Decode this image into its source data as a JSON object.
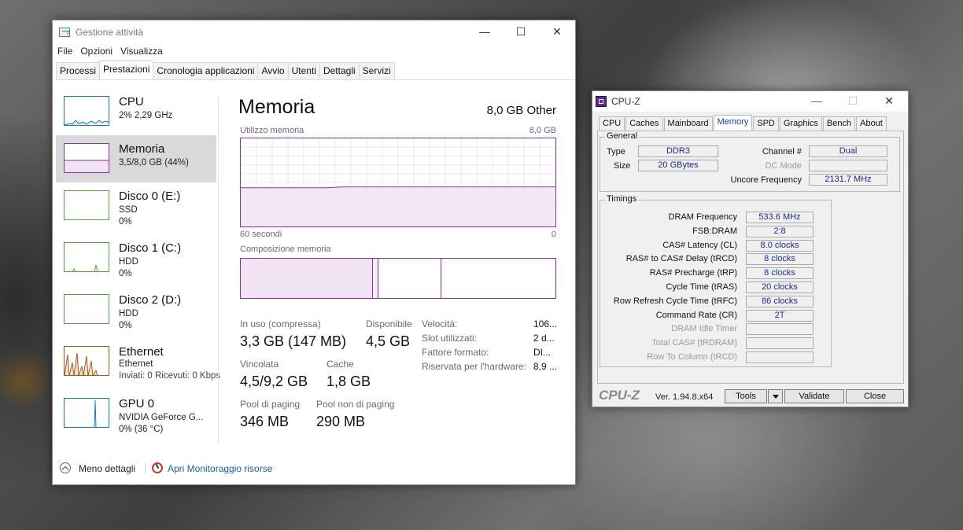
{
  "taskmanager": {
    "title": "Gestione attività",
    "menu": [
      "File",
      "Opzioni",
      "Visualizza"
    ],
    "tabs": [
      "Processi",
      "Prestazioni",
      "Cronologia applicazioni",
      "Avvio",
      "Utenti",
      "Dettagli",
      "Servizi"
    ],
    "active_tab": "Prestazioni",
    "sidebar": [
      {
        "name": "CPU",
        "line1": "2% 2,29 GHz",
        "line2": "",
        "color": "#1779ba"
      },
      {
        "name": "Memoria",
        "line1": "3,5/8,0 GB (44%)",
        "line2": "",
        "color": "#8b2fa3"
      },
      {
        "name": "Disco 0 (E:)",
        "line1": "SSD",
        "line2": "0%",
        "color": "#4ea73a"
      },
      {
        "name": "Disco 1 (C:)",
        "line1": "HDD",
        "line2": "0%",
        "color": "#4ea73a"
      },
      {
        "name": "Disco 2 (D:)",
        "line1": "HDD",
        "line2": "0%",
        "color": "#4ea73a"
      },
      {
        "name": "Ethernet",
        "line1": "Ethernet",
        "line2": "Inviati: 0 Ricevuti: 0 Kbps",
        "color": "#a7581a"
      },
      {
        "name": "GPU 0",
        "line1": "NVIDIA GeForce G...",
        "line2": "0% (36 °C)",
        "color": "#1779ba"
      }
    ],
    "main": {
      "title": "Memoria",
      "capacity": "8,0 GB Other",
      "graph_label": "Utilizzo memoria",
      "graph_max": "8,0 GB",
      "graph_time": "60 secondi",
      "graph_zero": "0",
      "graph_level": 0.44,
      "comp_label": "Composizione memoria",
      "stats": {
        "in_use_label": "In uso (compressa)",
        "in_use_value": "3,3 GB (147 MB)",
        "available_label": "Disponibile",
        "available_value": "4,5 GB",
        "committed_label": "Vincolata",
        "committed_value": "4,5/9,2 GB",
        "cache_label": "Cache",
        "cache_value": "1,8 GB",
        "paged_label": "Pool di paging",
        "paged_value": "346 MB",
        "nonpaged_label": "Pool non di paging",
        "nonpaged_value": "290 MB"
      },
      "details": [
        {
          "label": "Velocità:",
          "value": "106..."
        },
        {
          "label": "Slot utilizzati:",
          "value": "2 d..."
        },
        {
          "label": "Fattore formato:",
          "value": "DI..."
        },
        {
          "label": "Riservata per l'hardware:",
          "value": "8,9 ..."
        }
      ]
    },
    "footer": {
      "less_details": "Meno dettagli",
      "monitor_link": "Apri Monitoraggio risorse"
    }
  },
  "cpuz": {
    "title": "CPU-Z",
    "tabs": [
      "CPU",
      "Caches",
      "Mainboard",
      "Memory",
      "SPD",
      "Graphics",
      "Bench",
      "About"
    ],
    "active_tab": "Memory",
    "general": {
      "title": "General",
      "type_label": "Type",
      "type_value": "DDR3",
      "size_label": "Size",
      "size_value": "20 GBytes",
      "channel_label": "Channel #",
      "channel_value": "Dual",
      "dcmode_label": "DC Mode",
      "dcmode_value": "",
      "uncore_label": "Uncore Frequency",
      "uncore_value": "2131.7 MHz"
    },
    "timings": {
      "title": "Timings",
      "rows": [
        {
          "label": "DRAM Frequency",
          "value": "533.6 MHz",
          "enabled": true
        },
        {
          "label": "FSB:DRAM",
          "value": "2:8",
          "enabled": true
        },
        {
          "label": "CAS# Latency (CL)",
          "value": "8.0 clocks",
          "enabled": true
        },
        {
          "label": "RAS# to CAS# Delay (tRCD)",
          "value": "8 clocks",
          "enabled": true
        },
        {
          "label": "RAS# Precharge (tRP)",
          "value": "8 clocks",
          "enabled": true
        },
        {
          "label": "Cycle Time (tRAS)",
          "value": "20 clocks",
          "enabled": true
        },
        {
          "label": "Row Refresh Cycle Time (tRFC)",
          "value": "86 clocks",
          "enabled": true
        },
        {
          "label": "Command Rate (CR)",
          "value": "2T",
          "enabled": true
        },
        {
          "label": "DRAM Idle Timer",
          "value": "",
          "enabled": false
        },
        {
          "label": "Total CAS# (tRDRAM)",
          "value": "",
          "enabled": false
        },
        {
          "label": "Row To Column (tRCD)",
          "value": "",
          "enabled": false
        }
      ]
    },
    "footer": {
      "logo": "CPU-Z",
      "version": "Ver. 1.94.8.x64",
      "tools": "Tools",
      "validate": "Validate",
      "close": "Close"
    }
  }
}
